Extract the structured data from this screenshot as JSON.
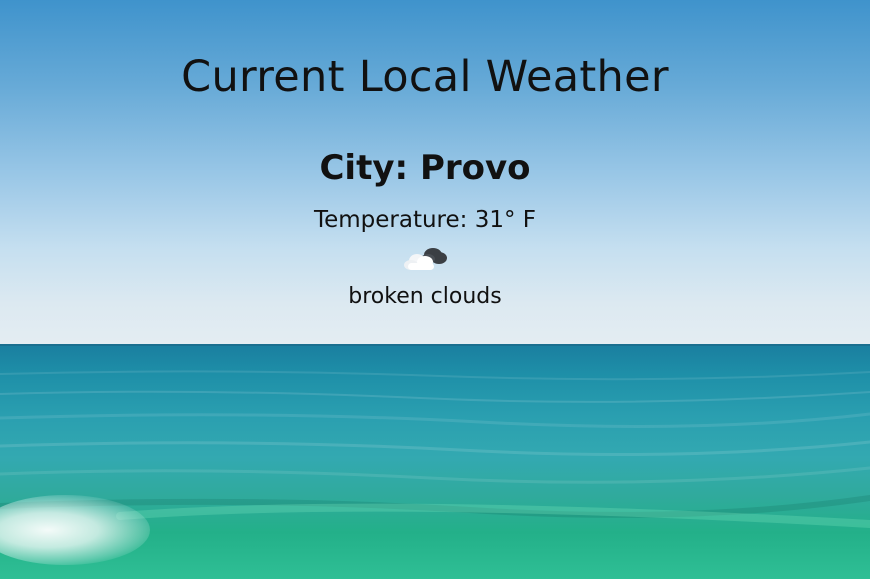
{
  "page": {
    "title": "Current Local Weather"
  },
  "weather": {
    "city_label": "City: Provo",
    "temperature_label": "Temperature: 31° F",
    "description": "broken clouds",
    "icon": "broken-clouds-icon"
  },
  "colors": {
    "text": "#111111",
    "sky_top": "#3f93cc",
    "sky_horizon": "#e4edf2",
    "sea_deep": "#1a7fa0",
    "sea_shallow": "#2fbf95"
  }
}
